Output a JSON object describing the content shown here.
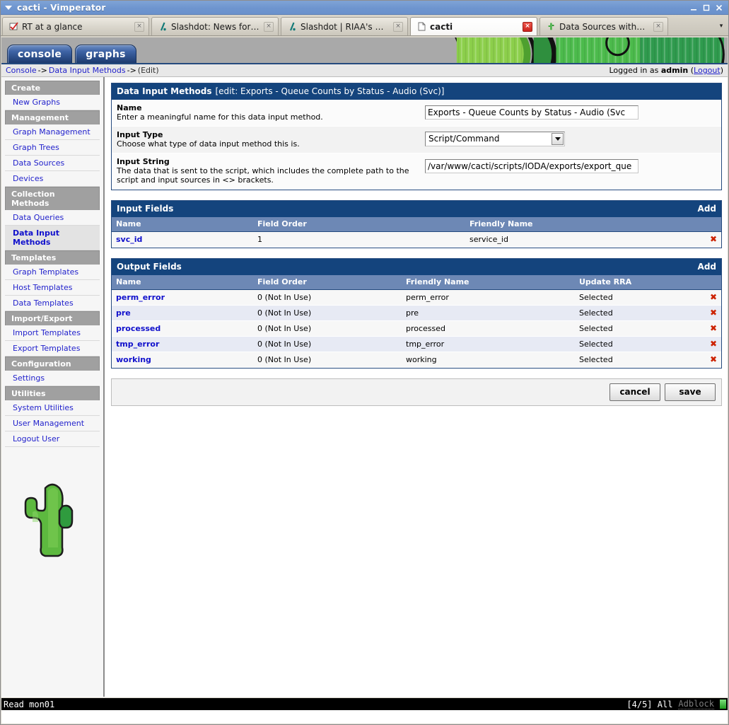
{
  "window": {
    "title": "cacti - Vimperator",
    "buttons": {
      "minimize": "–",
      "maximize": "□",
      "close": "✕"
    }
  },
  "browser": {
    "tabs": [
      {
        "label": "RT at a glance",
        "favicon": "checkmark-icon",
        "active": false,
        "close": "×"
      },
      {
        "label": "Slashdot: News for n...",
        "favicon": "slashdot-icon",
        "active": false,
        "close": "×"
      },
      {
        "label": "Slashdot | RIAA's Bos...",
        "favicon": "slashdot-icon",
        "active": false,
        "close": "×"
      },
      {
        "label": "cacti",
        "favicon": "page-icon",
        "active": true,
        "close": "×"
      },
      {
        "label": "Data Sources withou...",
        "favicon": "cactus-icon",
        "active": false,
        "close": "×"
      }
    ],
    "scroll_down": "▾"
  },
  "cacti": {
    "tabs": [
      {
        "label": "console",
        "active": true
      },
      {
        "label": "graphs",
        "active": false
      }
    ],
    "breadcrumb": {
      "items": [
        "Console",
        "Data Input Methods",
        "(Edit)"
      ],
      "separator": "->"
    },
    "login": {
      "prefix": "Logged in as",
      "user": "admin",
      "open_paren": "(",
      "logout": "Logout",
      "close_paren": ")"
    },
    "logo": "cactus-icon"
  },
  "sidebar": {
    "sections": [
      {
        "heading": "Create",
        "items": [
          {
            "label": "New Graphs",
            "current": false
          }
        ]
      },
      {
        "heading": "Management",
        "items": [
          {
            "label": "Graph Management",
            "current": false
          },
          {
            "label": "Graph Trees",
            "current": false
          },
          {
            "label": "Data Sources",
            "current": false
          },
          {
            "label": "Devices",
            "current": false
          }
        ]
      },
      {
        "heading": "Collection Methods",
        "items": [
          {
            "label": "Data Queries",
            "current": false
          },
          {
            "label": "Data Input Methods",
            "current": true
          }
        ]
      },
      {
        "heading": "Templates",
        "items": [
          {
            "label": "Graph Templates",
            "current": false
          },
          {
            "label": "Host Templates",
            "current": false
          },
          {
            "label": "Data Templates",
            "current": false
          }
        ]
      },
      {
        "heading": "Import/Export",
        "items": [
          {
            "label": "Import Templates",
            "current": false
          },
          {
            "label": "Export Templates",
            "current": false
          }
        ]
      },
      {
        "heading": "Configuration",
        "items": [
          {
            "label": "Settings",
            "current": false
          }
        ]
      },
      {
        "heading": "Utilities",
        "items": [
          {
            "label": "System Utilities",
            "current": false
          },
          {
            "label": "User Management",
            "current": false
          },
          {
            "label": "Logout User",
            "current": false
          }
        ]
      }
    ]
  },
  "main": {
    "edit_panel": {
      "title": "Data Input Methods",
      "subtitle": "[edit: Exports - Queue Counts by Status - Audio (Svc)]",
      "rows": [
        {
          "label": "Name",
          "desc": "Enter a meaningful name for this data input method.",
          "control": "text",
          "value": "Exports - Queue Counts by Status - Audio (Svc"
        },
        {
          "label": "Input Type",
          "desc": "Choose what type of data input method this is.",
          "control": "select",
          "value": "Script/Command"
        },
        {
          "label": "Input String",
          "desc": "The data that is sent to the script, which includes the complete path to the script and input sources in <> brackets.",
          "control": "text",
          "value": "/var/www/cacti/scripts/IODA/exports/export_que"
        }
      ]
    },
    "input_fields": {
      "title": "Input Fields",
      "add_label": "Add",
      "columns": [
        "Name",
        "Field Order",
        "Friendly Name"
      ],
      "rows": [
        {
          "name": "svc_id",
          "order": "1",
          "friendly": "service_id",
          "delete": "✖"
        }
      ]
    },
    "output_fields": {
      "title": "Output Fields",
      "add_label": "Add",
      "columns": [
        "Name",
        "Field Order",
        "Friendly Name",
        "Update RRA"
      ],
      "rows": [
        {
          "name": "perm_error",
          "order": "0 (Not In Use)",
          "friendly": "perm_error",
          "rra": "Selected",
          "delete": "✖"
        },
        {
          "name": "pre",
          "order": "0 (Not In Use)",
          "friendly": "pre",
          "rra": "Selected",
          "delete": "✖"
        },
        {
          "name": "processed",
          "order": "0 (Not In Use)",
          "friendly": "processed",
          "rra": "Selected",
          "delete": "✖"
        },
        {
          "name": "tmp_error",
          "order": "0 (Not In Use)",
          "friendly": "tmp_error",
          "rra": "Selected",
          "delete": "✖"
        },
        {
          "name": "working",
          "order": "0 (Not In Use)",
          "friendly": "working",
          "rra": "Selected",
          "delete": "✖"
        }
      ]
    },
    "buttons": {
      "cancel": "cancel",
      "save": "save"
    }
  },
  "statusline": {
    "left": "Read mon01",
    "position": "[4/5] All",
    "adblock": "Adblock"
  },
  "colors": {
    "titlebar": "#6e95cf",
    "panel_header": "#14447d",
    "table_header": "#6d88b5",
    "link": "#2222cc",
    "nav_heading": "#a0a0a0",
    "delete_x": "#cc2200",
    "row_odd": "#f7f7f7",
    "row_even": "#e7eaf4"
  }
}
